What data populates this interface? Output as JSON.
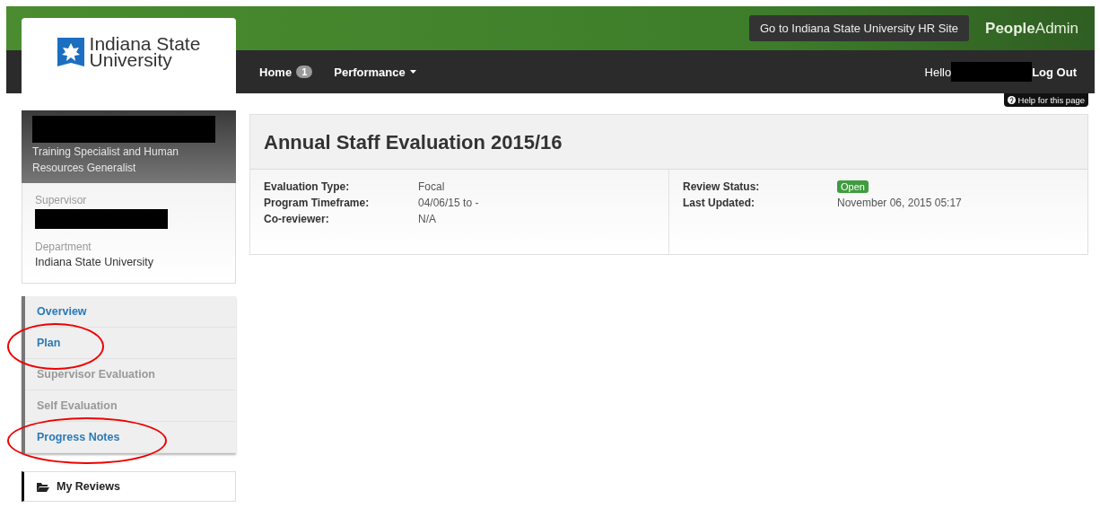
{
  "header": {
    "logo": {
      "line1": "Indiana State",
      "line2": "University"
    },
    "hr_site_button": "Go to Indiana State University HR Site",
    "brand": {
      "bold": "People",
      "light": "Admin"
    },
    "nav": [
      {
        "label": "Home",
        "badge": "1",
        "dropdown": false
      },
      {
        "label": "Performance",
        "dropdown": true
      }
    ],
    "greeting": "Hello",
    "logout": "Log Out"
  },
  "help": "Help for this page",
  "profile": {
    "title_line1": "Training Specialist and Human",
    "title_line2": "Resources Generalist",
    "fields": [
      {
        "label": "Supervisor",
        "redacted": true
      },
      {
        "label": "Department",
        "value": "Indiana State University",
        "redacted": false
      }
    ]
  },
  "sidebar_nav": [
    {
      "label": "Overview",
      "disabled": false,
      "circled": false
    },
    {
      "label": "Plan",
      "disabled": false,
      "circled": true
    },
    {
      "label": "Supervisor Evaluation",
      "disabled": true,
      "circled": false
    },
    {
      "label": "Self Evaluation",
      "disabled": true,
      "circled": false
    },
    {
      "label": "Progress Notes",
      "disabled": false,
      "circled": true
    }
  ],
  "my_reviews": "My Reviews",
  "evaluation": {
    "title": "Annual Staff Evaluation 2015/16",
    "left": [
      {
        "label": "Evaluation Type:",
        "value": "Focal",
        "kind": "text"
      },
      {
        "label": "Program Timeframe:",
        "value": "04/06/15 to -",
        "kind": "text"
      },
      {
        "label": "Co-reviewer:",
        "value": "N/A",
        "kind": "text"
      }
    ],
    "right": [
      {
        "label": "Review Status:",
        "value": "Open",
        "kind": "badge"
      },
      {
        "label": "Last Updated:",
        "value": "November 06, 2015 05:17",
        "kind": "text"
      }
    ]
  }
}
